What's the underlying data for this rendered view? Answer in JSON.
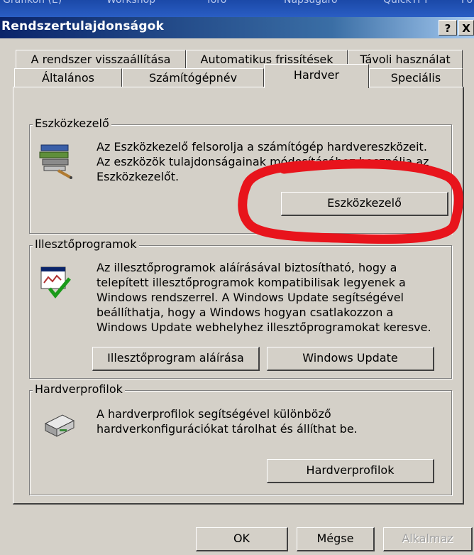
{
  "window": {
    "clipped_strip_items": [
      "Grafikon (E)",
      "Workshop",
      "Yoro",
      "Napsugaro",
      "QuickTFT",
      "Fo"
    ],
    "title": "Rendszertulajdonságok",
    "help_label": "?",
    "close_label": "X"
  },
  "tabs": {
    "row_back": [
      {
        "label": "A rendszer visszaállítása"
      },
      {
        "label": "Automatikus frissítések"
      },
      {
        "label": "Távoli használat"
      }
    ],
    "row_front": [
      {
        "label": "Általános"
      },
      {
        "label": "Számítógépnév"
      },
      {
        "label": "Hardver"
      },
      {
        "label": "Speciális"
      }
    ],
    "selected": "Hardver"
  },
  "device_manager": {
    "legend": "Eszközkezelő",
    "description": "Az Eszközkezelő felsorolja a számítógép hardvereszközeit. Az eszközök tulajdonságainak módosításához használja az Eszközkezelőt.",
    "button_label": "Eszközkezelő",
    "icon": "device-manager-icon"
  },
  "drivers": {
    "legend": "Illesztőprogramok",
    "description": "Az illesztőprogramok aláírásával biztosítható, hogy a telepített illesztőprogramok kompatibilisak legyenek a Windows rendszerrel. A Windows Update segítségével beállíthatja, hogy a Windows hogyan csatlakozzon a Windows Update webhelyhez illesztőprogramokat keresve.",
    "signing_button_label": "Illesztőprogram aláírása",
    "update_button_label": "Windows Update",
    "icon": "driver-signing-icon"
  },
  "hardware_profiles": {
    "legend": "Hardverprofilok",
    "description": "A hardverprofilok segítségével különböző hardverkonfigurációkat tárolhat és állíthat be.",
    "button_label": "Hardverprofilok",
    "icon": "hardware-profile-icon"
  },
  "footer": {
    "ok_label": "OK",
    "cancel_label": "Mégse",
    "apply_label": "Alkalmaz",
    "apply_enabled": false
  },
  "colors": {
    "titlebar_start": "#0a246a",
    "titlebar_end": "#a6caf0",
    "dialog_face": "#d4d0c8",
    "annotation_red": "#e8141c"
  }
}
